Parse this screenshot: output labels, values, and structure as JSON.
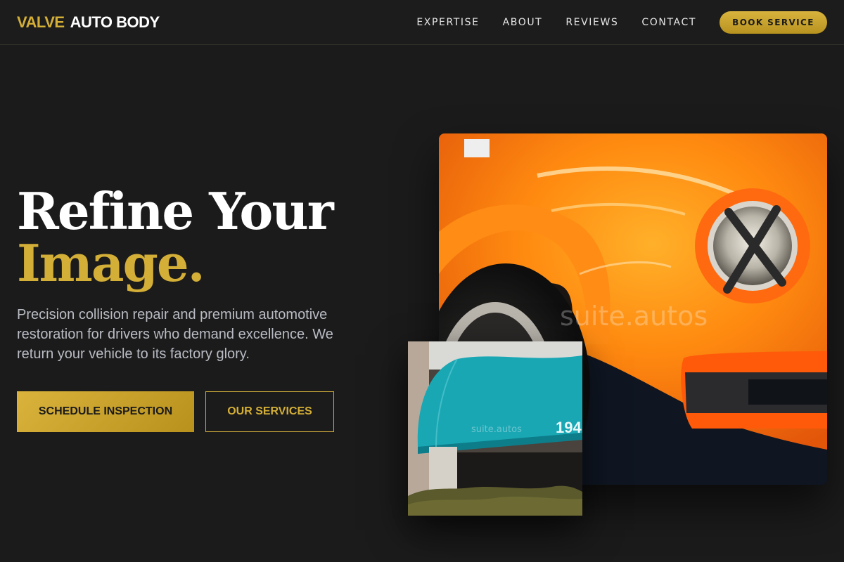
{
  "brand": {
    "part1": "VALVE",
    "part2": "AUTO BODY"
  },
  "nav": {
    "links": [
      "EXPERTISE",
      "ABOUT",
      "REVIEWS",
      "CONTACT"
    ],
    "cta": "BOOK SERVICE"
  },
  "hero": {
    "title_line1": "Refine Your",
    "title_line2": "Image.",
    "description": "Precision collision repair and premium automotive restoration for drivers who demand excellence. We return your vehicle to its factory glory.",
    "primary_button": "SCHEDULE INSPECTION",
    "secondary_button": "OUR SERVICES"
  },
  "images": {
    "main_watermark": "suite.autos",
    "small_watermark": "suite.autos",
    "small_sign_number": "194"
  },
  "colors": {
    "accent": "#d4af37",
    "background": "#1b1b1b",
    "text_muted": "#b9bcc4"
  }
}
